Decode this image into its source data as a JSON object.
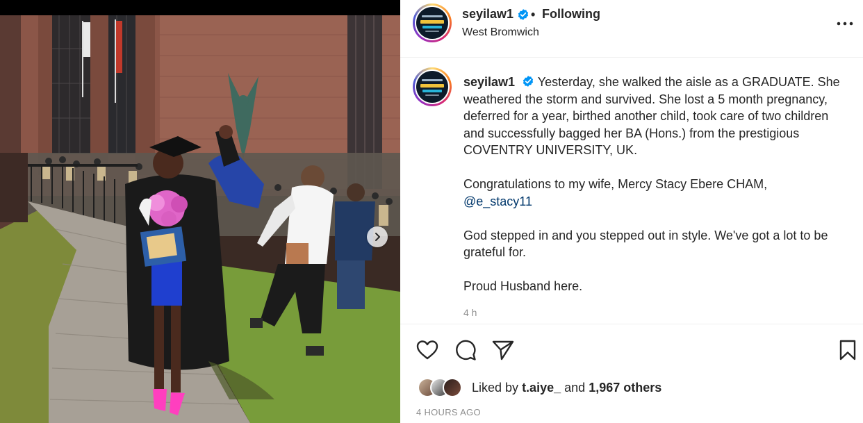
{
  "post": {
    "username": "seyilaw1",
    "follow_status": "Following",
    "separator": "•",
    "location": "West Bromwich",
    "caption": {
      "username": "seyilaw1",
      "line1": "Yesterday, she walked the aisle as a GRADUATE. She weathered the storm and survived. She lost a 5 month pregnancy, deferred for a year, birthed another child, took care of two children and successfully bagged her BA (Hons.) from the prestigious COVENTRY UNIVERSITY, UK.",
      "line2_text": "Congratulations to my wife, Mercy Stacy Ebere CHAM,",
      "line2_mention": "@e_stacy11",
      "line3": "God stepped in and you stepped out in style. We've got a lot to be grateful for.",
      "line4": "Proud Husband here."
    },
    "caption_time": "4 h",
    "likes": {
      "prefix": "Liked by",
      "liker": "t.aiye_",
      "conjunction": "and",
      "others": "1,967 others"
    },
    "post_date": "4 HOURS AGO"
  },
  "icons": {
    "verified": "verified-badge-icon",
    "more": "more-options-icon",
    "like": "heart-icon",
    "comment": "comment-icon",
    "share": "send-icon",
    "save": "bookmark-icon",
    "next": "chevron-right-icon"
  },
  "colors": {
    "verified": "#0095f6",
    "text": "#262626",
    "muted": "#8e8e8e",
    "mention": "#00376b",
    "shoes": "#ff3fbf",
    "flowers": "#e066c8"
  }
}
